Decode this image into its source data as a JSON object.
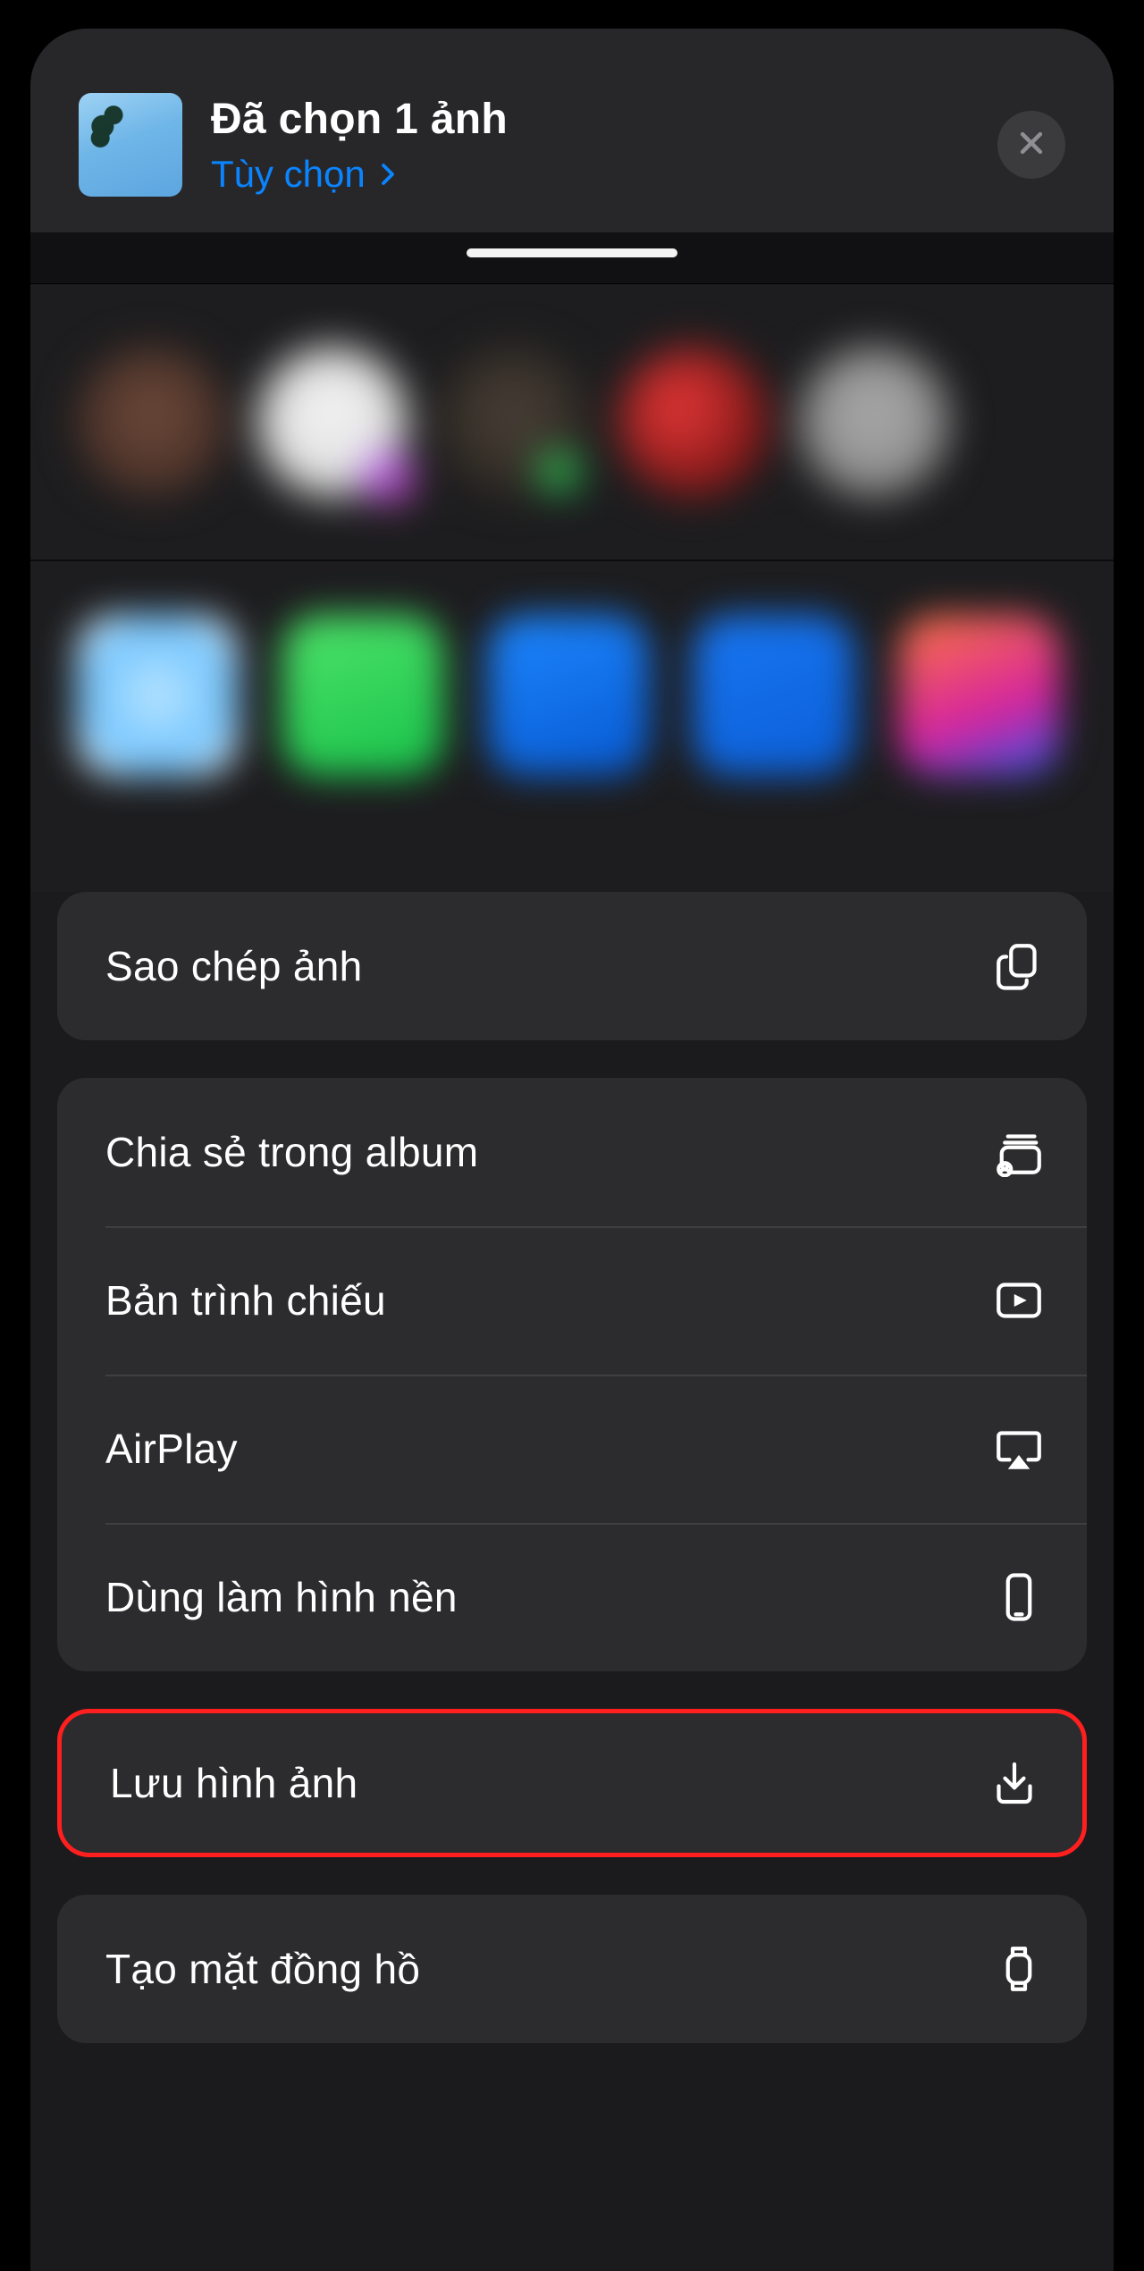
{
  "header": {
    "title": "Đã chọn 1 ảnh",
    "options_label": "Tùy chọn"
  },
  "actions": {
    "copy": "Sao chép ảnh",
    "share_album": "Chia sẻ trong album",
    "slideshow": "Bản trình chiếu",
    "airplay": "AirPlay",
    "wallpaper": "Dùng làm hình nền",
    "save_image": "Lưu hình ảnh",
    "watch_face": "Tạo mặt đồng hồ"
  }
}
